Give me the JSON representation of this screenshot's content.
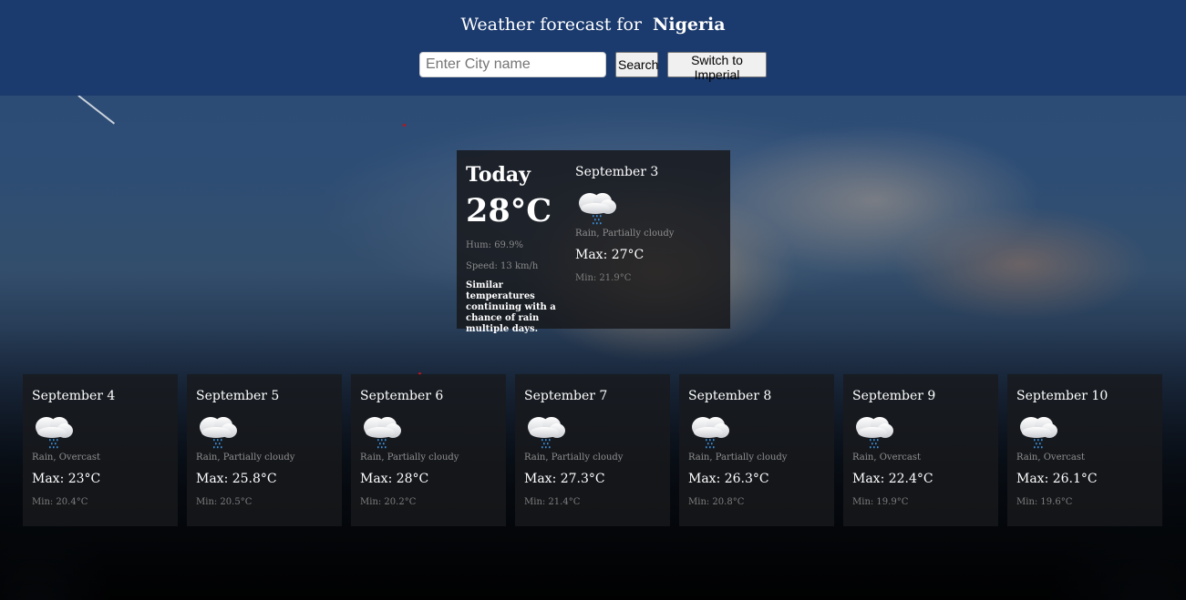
{
  "header": {
    "title_prefix": "Weather forecast for",
    "location": "Nigeria",
    "search_placeholder": "Enter City name",
    "search_label": "Search",
    "units_toggle_label": "Switch to Imperial"
  },
  "today": {
    "label": "Today",
    "temperature": "28°C",
    "humidity": "Hum: 69.9%",
    "wind_speed": "Speed: 13 km/h",
    "summary": "Similar temperatures continuing with a chance of rain multiple days.",
    "forecast": {
      "date": "September 3",
      "icon": "rain-cloud-icon",
      "condition": "Rain, Partially cloudy",
      "max": "Max: 27°C",
      "min": "Min: 21.9°C"
    }
  },
  "days": [
    {
      "date": "September 4",
      "icon": "rain-cloud-icon",
      "condition": "Rain, Overcast",
      "max": "Max: 23°C",
      "min": "Min: 20.4°C"
    },
    {
      "date": "September 5",
      "icon": "rain-cloud-icon",
      "condition": "Rain, Partially cloudy",
      "max": "Max: 25.8°C",
      "min": "Min: 20.5°C"
    },
    {
      "date": "September 6",
      "icon": "rain-cloud-icon",
      "condition": "Rain, Partially cloudy",
      "max": "Max: 28°C",
      "min": "Min: 20.2°C"
    },
    {
      "date": "September 7",
      "icon": "rain-cloud-icon",
      "condition": "Rain, Partially cloudy",
      "max": "Max: 27.3°C",
      "min": "Min: 21.4°C"
    },
    {
      "date": "September 8",
      "icon": "rain-cloud-icon",
      "condition": "Rain, Partially cloudy",
      "max": "Max: 26.3°C",
      "min": "Min: 20.8°C"
    },
    {
      "date": "September 9",
      "icon": "rain-cloud-icon",
      "condition": "Rain, Overcast",
      "max": "Max: 22.4°C",
      "min": "Min: 19.9°C"
    },
    {
      "date": "September 10",
      "icon": "rain-cloud-icon",
      "condition": "Rain, Overcast",
      "max": "Max: 26.1°C",
      "min": "Min: 19.6°C"
    }
  ],
  "colors": {
    "header_bg": "#1b3a6d",
    "card_bg": "#18191c",
    "rain_drop": "#3b8fd9"
  }
}
